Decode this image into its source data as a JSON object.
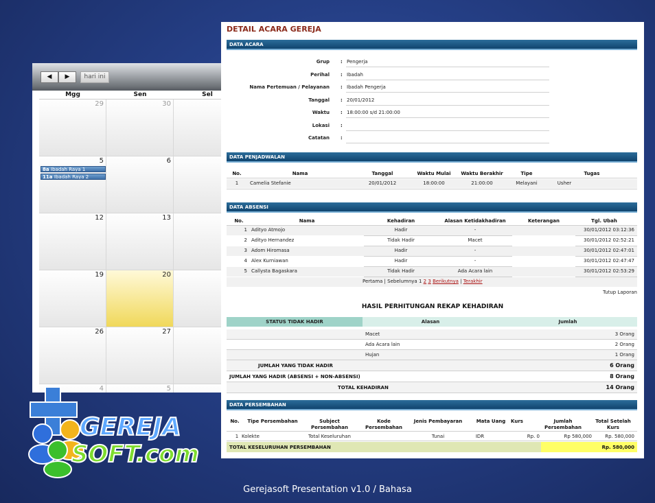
{
  "calendar": {
    "prev_label": "◀",
    "next_label": "▶",
    "today_label": "hari ini",
    "days": [
      "Mgg",
      "Sen",
      "Sel"
    ],
    "rows": [
      [
        "29",
        "30",
        ""
      ],
      [
        "5",
        "6",
        ""
      ],
      [
        "12",
        "13",
        ""
      ],
      [
        "19",
        "20",
        ""
      ],
      [
        "26",
        "27",
        ""
      ],
      [
        "4",
        "5",
        ""
      ]
    ],
    "events": [
      {
        "time": "8a",
        "title": "Ibadah Raya 1"
      },
      {
        "time": "11a",
        "title": "Ibadah Raya 2"
      }
    ]
  },
  "logo": {
    "line1": "GEREJA",
    "line2": "SOFT.com"
  },
  "doc": {
    "title": "DETAIL ACARA GEREJA",
    "data_acara": {
      "heading": "DATA ACARA",
      "fields": [
        {
          "label": "Grup",
          "value": "Pengerja"
        },
        {
          "label": "Perihal",
          "value": "Ibadah"
        },
        {
          "label": "Nama Pertemuan / Pelayanan",
          "value": "Ibadah Pengerja"
        },
        {
          "label": "Tanggal",
          "value": "20/01/2012"
        },
        {
          "label": "Waktu",
          "value": "18:00:00 s/d 21:00:00"
        },
        {
          "label": "Lokasi",
          "value": ""
        },
        {
          "label": "Catatan",
          "value": ""
        }
      ]
    },
    "penjadwalan": {
      "heading": "DATA PENJADWALAN",
      "columns": [
        "No.",
        "Nama",
        "Tanggal",
        "Waktu Mulai",
        "Waktu Berakhir",
        "Tipe",
        "Tugas"
      ],
      "rows": [
        [
          "1",
          "Camelia Stefanie",
          "20/01/2012",
          "18:00:00",
          "21:00:00",
          "Melayani",
          "Usher"
        ]
      ]
    },
    "absensi": {
      "heading": "DATA ABSENSI",
      "columns": [
        "No.",
        "Nama",
        "Kehadiran",
        "Alasan Ketidakhadiran",
        "Keterangan",
        "Tgl. Ubah"
      ],
      "rows": [
        [
          "1",
          "Adityo Atmojo",
          "Hadir",
          "-",
          "",
          "30/01/2012 03:12:36"
        ],
        [
          "2",
          "Adityo Hernandez",
          "Tidak Hadir",
          "Macet",
          "",
          "30/01/2012 02:52:21"
        ],
        [
          "3",
          "Adom Hiromasa",
          "Hadir",
          "-",
          "",
          "30/01/2012 02:47:01"
        ],
        [
          "4",
          "Alex Kurniawan",
          "Hadir",
          "-",
          "",
          "30/01/2012 02:47:47"
        ],
        [
          "5",
          "Callysta Bagaskara",
          "Tidak Hadir",
          "Ada Acara lain",
          "",
          "30/01/2012 02:53:29"
        ]
      ],
      "pager": {
        "first": "Pertama",
        "prev": "Sebelumnya",
        "p1": "1",
        "p2": "2",
        "p3": "3",
        "next": "Berikutnya",
        "last": "Terakhir",
        "sep": "|"
      },
      "close_report": "Tutup Laporan"
    },
    "rekap": {
      "title": "HASIL PERHITUNGAN REKAP KEHADIRAN",
      "columns": [
        "STATUS TIDAK HADIR",
        "Alasan",
        "Jumlah"
      ],
      "reasons": [
        {
          "alasan": "Macet",
          "jumlah": "3 Orang"
        },
        {
          "alasan": "Ada Acara lain",
          "jumlah": "2 Orang"
        },
        {
          "alasan": "Hujan",
          "jumlah": "1 Orang"
        }
      ],
      "totals": [
        {
          "label": "JUMLAH YANG TIDAK HADIR",
          "value": "6 Orang"
        },
        {
          "label": "JUMLAH YANG HADIR (ABSENSI + NON-ABSENSI)",
          "value": "8 Orang"
        },
        {
          "label": "TOTAL KEHADIRAN",
          "value": "14 Orang"
        }
      ]
    },
    "persembahan": {
      "heading": "DATA PERSEMBAHAN",
      "columns": [
        "No.",
        "Tipe Persembahan",
        "Subject Persembahan",
        "Kode Persembahan",
        "Jenis Pembayaran",
        "Mata Uang",
        "Kurs",
        "Jumlah Persembahan",
        "Total Setelah Kurs"
      ],
      "rows": [
        [
          "1",
          "Kolekte",
          "Total Keseluruhan",
          "",
          "Tunai",
          "IDR",
          "Rp. 0",
          "Rp 580,000",
          "Rp. 580,000"
        ]
      ],
      "total_label": "TOTAL KESELURUHAN PERSEMBAHAN",
      "total_value": "Rp. 580,000"
    }
  },
  "footer": "Gerejasoft Presentation v1.0 / Bahasa",
  "colors": {
    "header_bar": "#10446e",
    "rekap_head": "#9fd3c8",
    "total_yellow": "#ffff66",
    "title_red": "#8b2a1a"
  }
}
